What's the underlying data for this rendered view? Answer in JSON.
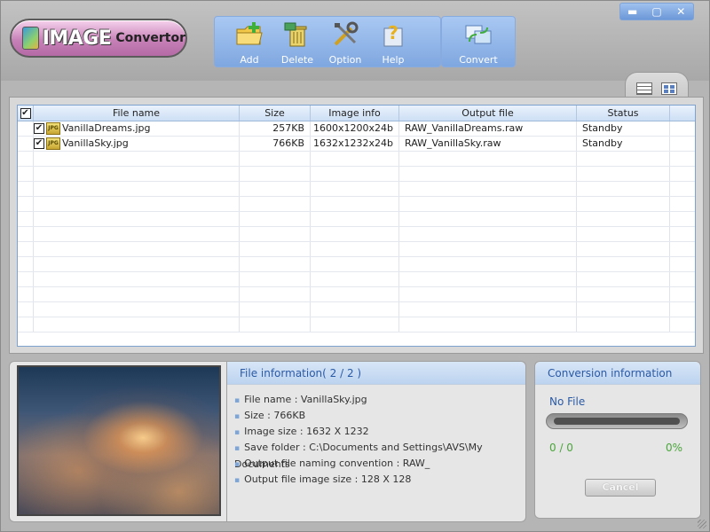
{
  "window": {
    "controls": [
      {
        "name": "minimize",
        "glyph": "▬"
      },
      {
        "name": "maximize",
        "glyph": "▢"
      },
      {
        "name": "close",
        "glyph": "✕"
      }
    ]
  },
  "logo": {
    "big": "IMAGE",
    "small": "Convertor"
  },
  "toolbar": {
    "add": "Add",
    "delete": "Delete",
    "option": "Option",
    "help": "Help",
    "convert": "Convert"
  },
  "icons": {
    "add": "folder-add-icon",
    "delete": "trash-icon",
    "option": "tools-icon",
    "help": "help-icon",
    "convert": "convert-icon",
    "view_list": "list-view-icon",
    "view_tile": "tile-view-icon"
  },
  "table": {
    "headers": [
      "File name",
      "Size",
      "Image info",
      "Output file",
      "Status"
    ],
    "rows": [
      {
        "checked": true,
        "file_name": "VanillaDreams.jpg",
        "size": "257KB",
        "image_info": "1600x1200x24b",
        "output_file": "RAW_VanillaDreams.raw",
        "status": "Standby"
      },
      {
        "checked": true,
        "file_name": "VanillaSky.jpg",
        "size": "766KB",
        "image_info": "1632x1232x24b",
        "output_file": "RAW_VanillaSky.raw",
        "status": "Standby"
      }
    ],
    "file_icon_text": "JPG"
  },
  "file_info": {
    "title": "File information( 2 / 2 )",
    "items": [
      "File name :  VanillaSky.jpg",
      "Size : 766KB",
      "Image size : 1632 X 1232",
      "Save folder :  C:\\Documents and Settings\\AVS\\My Documents",
      "Output file naming convention : RAW_",
      "Output file image size : 128 X 128"
    ]
  },
  "conversion": {
    "title": "Conversion information",
    "status": "No File",
    "count": "0 / 0",
    "percent": "0%",
    "progress": 0,
    "cancel": "Cancel"
  },
  "colors": {
    "accent_blue": "#2a5aa6",
    "toolbar_blue": "#7fa7e0",
    "progress_green": "#4aa53a"
  }
}
